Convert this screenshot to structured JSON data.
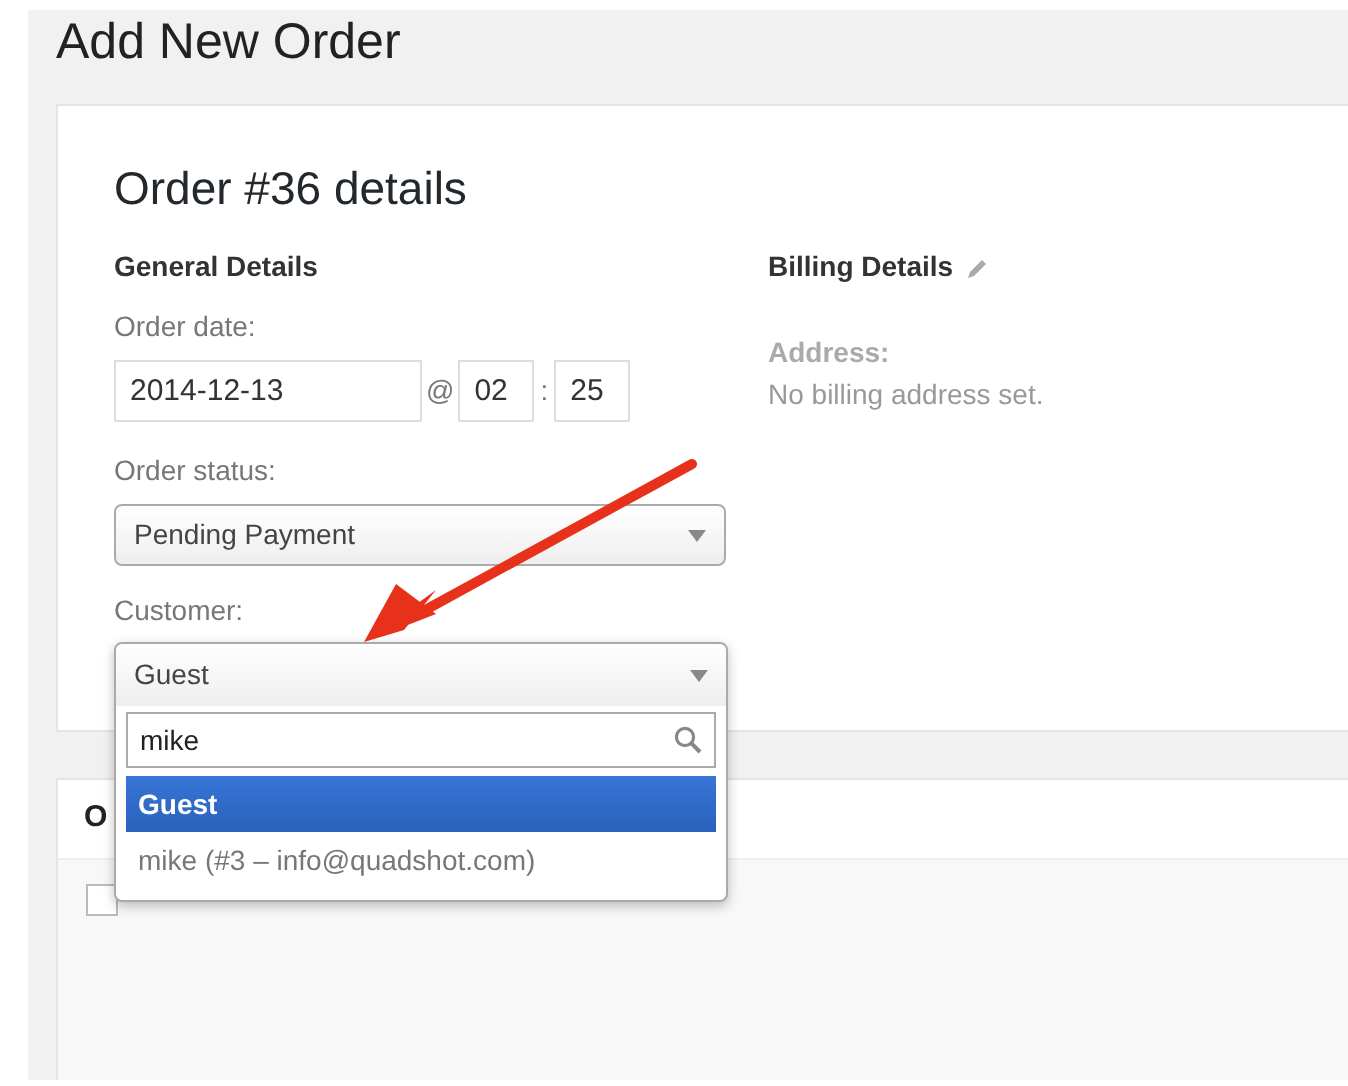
{
  "page_title": "Add New Order",
  "order_panel": {
    "title": "Order #36 details",
    "general": {
      "heading": "General Details",
      "date_label": "Order date:",
      "date": "2014-12-13",
      "at": "@",
      "hour": "02",
      "colon": ":",
      "minute": "25",
      "status_label": "Order status:",
      "status": "Pending Payment",
      "customer_label": "Customer:",
      "customer": "Guest"
    },
    "billing": {
      "heading": "Billing Details",
      "address_label": "Address:",
      "address": "No billing address set."
    }
  },
  "customer_dropdown": {
    "search": "mike",
    "options": [
      {
        "label": "Guest",
        "selected": true
      },
      {
        "label": "mike (#3 – info@quadshot.com)",
        "selected": false
      }
    ]
  },
  "items_panel": {
    "heading": "O",
    "select_all_checked": false
  }
}
